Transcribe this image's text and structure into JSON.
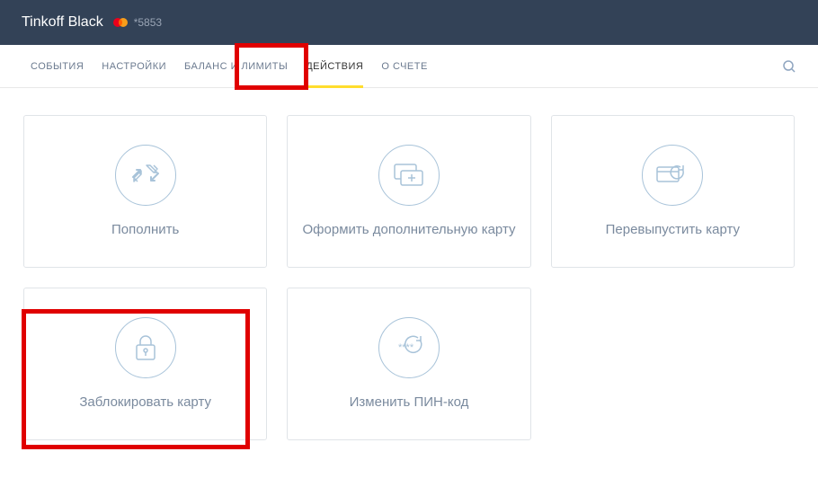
{
  "header": {
    "card_title": "Tinkoff Black",
    "card_number": "*5853"
  },
  "tabs": {
    "items": [
      {
        "label": "СОБЫТИЯ"
      },
      {
        "label": "НАСТРОЙКИ"
      },
      {
        "label": "БАЛАНС И ЛИМИТЫ"
      },
      {
        "label": "ДЕЙСТВИЯ"
      },
      {
        "label": "О СЧЕТЕ"
      }
    ]
  },
  "actions": {
    "topup": "Пополнить",
    "additional_card": "Оформить дополнительную карту",
    "reissue": "Перевыпустить карту",
    "block": "Заблокировать карту",
    "change_pin": "Изменить ПИН-код"
  }
}
